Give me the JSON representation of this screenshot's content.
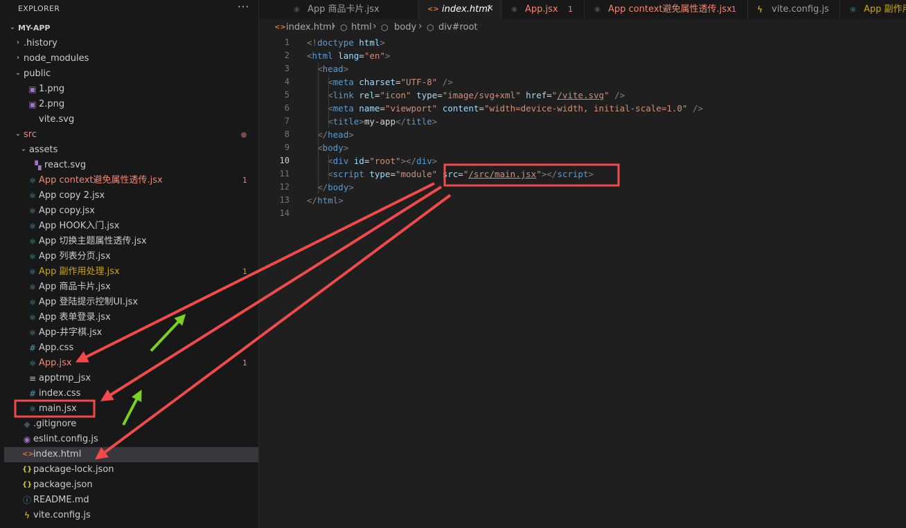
{
  "explorer": {
    "title": "EXPLORER",
    "more": "···",
    "items": [
      {
        "label": "MY-APP",
        "chev": "⌄",
        "icon": "",
        "icon_color": "",
        "depth": 0,
        "color": "root",
        "badge": "",
        "dot": false,
        "selected": false,
        "icon_name": "chevron-down-icon"
      },
      {
        "label": ".history",
        "chev": "›",
        "icon": "",
        "icon_color": "",
        "depth": 1,
        "color": "default",
        "badge": "",
        "dot": false,
        "selected": false,
        "icon_name": "chevron-right-icon"
      },
      {
        "label": "node_modules",
        "chev": "›",
        "icon": "",
        "icon_color": "",
        "depth": 1,
        "color": "default",
        "badge": "",
        "dot": false,
        "selected": false,
        "icon_name": "chevron-right-icon"
      },
      {
        "label": "public",
        "chev": "⌄",
        "icon": "",
        "icon_color": "",
        "depth": 1,
        "color": "default",
        "badge": "",
        "dot": false,
        "selected": false,
        "icon_name": "chevron-down-icon"
      },
      {
        "label": "1.png",
        "chev": "",
        "icon": "▣",
        "icon_color": "#a074c4",
        "depth": 2,
        "color": "default",
        "badge": "",
        "dot": false,
        "selected": false,
        "icon_name": "image-file-icon"
      },
      {
        "label": "2.png",
        "chev": "",
        "icon": "▣",
        "icon_color": "#a074c4",
        "depth": 2,
        "color": "default",
        "badge": "",
        "dot": false,
        "selected": false,
        "icon_name": "image-file-icon"
      },
      {
        "label": "vite.svg",
        "chev": "",
        "icon": "",
        "icon_color": "",
        "depth": 2,
        "color": "default",
        "badge": "",
        "dot": false,
        "selected": false,
        "icon_name": "svg-file-icon"
      },
      {
        "label": "src",
        "chev": "⌄",
        "icon": "",
        "icon_color": "",
        "depth": 1,
        "color": "error",
        "badge": "",
        "dot": true,
        "selected": false,
        "icon_name": "chevron-down-icon"
      },
      {
        "label": "assets",
        "chev": "⌄",
        "icon": "",
        "icon_color": "",
        "depth": 2,
        "color": "default",
        "badge": "",
        "dot": false,
        "selected": false,
        "icon_name": "chevron-down-icon"
      },
      {
        "label": "react.svg",
        "chev": "",
        "icon": "▚",
        "icon_color": "#a074c4",
        "depth": 3,
        "color": "default",
        "badge": "",
        "dot": false,
        "selected": false,
        "icon_name": "svg-file-icon"
      },
      {
        "label": "App context避免属性透传.jsx",
        "chev": "",
        "icon": "⚛",
        "icon_color": "#519aba",
        "depth": 2,
        "color": "error",
        "badge": "1",
        "dot": false,
        "selected": false,
        "icon_name": "react-file-icon"
      },
      {
        "label": "App copy 2.jsx",
        "chev": "",
        "icon": "⚛",
        "icon_color": "#519aba",
        "depth": 2,
        "color": "default",
        "badge": "",
        "dot": false,
        "selected": false,
        "icon_name": "react-file-icon"
      },
      {
        "label": "App copy.jsx",
        "chev": "",
        "icon": "⚛",
        "icon_color": "#519aba",
        "depth": 2,
        "color": "default",
        "badge": "",
        "dot": false,
        "selected": false,
        "icon_name": "react-file-icon"
      },
      {
        "label": "App HOOK入门.jsx",
        "chev": "",
        "icon": "⚛",
        "icon_color": "#519aba",
        "depth": 2,
        "color": "default",
        "badge": "",
        "dot": false,
        "selected": false,
        "icon_name": "react-file-icon"
      },
      {
        "label": "App 切换主题属性透传.jsx",
        "chev": "",
        "icon": "⚛",
        "icon_color": "#519aba",
        "depth": 2,
        "color": "default",
        "badge": "",
        "dot": false,
        "selected": false,
        "icon_name": "react-file-icon"
      },
      {
        "label": "App 列表分页.jsx",
        "chev": "",
        "icon": "⚛",
        "icon_color": "#519aba",
        "depth": 2,
        "color": "default",
        "badge": "",
        "dot": false,
        "selected": false,
        "icon_name": "react-file-icon"
      },
      {
        "label": "App 副作用处理.jsx",
        "chev": "",
        "icon": "⚛",
        "icon_color": "#519aba",
        "depth": 2,
        "color": "warn",
        "badge": "1",
        "dot": false,
        "selected": false,
        "icon_name": "react-file-icon"
      },
      {
        "label": "App 商品卡片.jsx",
        "chev": "",
        "icon": "⚛",
        "icon_color": "#519aba",
        "depth": 2,
        "color": "default",
        "badge": "",
        "dot": false,
        "selected": false,
        "icon_name": "react-file-icon"
      },
      {
        "label": "App 登陆提示控制UI.jsx",
        "chev": "",
        "icon": "⚛",
        "icon_color": "#519aba",
        "depth": 2,
        "color": "default",
        "badge": "",
        "dot": false,
        "selected": false,
        "icon_name": "react-file-icon"
      },
      {
        "label": "App 表单登录.jsx",
        "chev": "",
        "icon": "⚛",
        "icon_color": "#519aba",
        "depth": 2,
        "color": "default",
        "badge": "",
        "dot": false,
        "selected": false,
        "icon_name": "react-file-icon"
      },
      {
        "label": "App-井字棋.jsx",
        "chev": "",
        "icon": "⚛",
        "icon_color": "#519aba",
        "depth": 2,
        "color": "default",
        "badge": "",
        "dot": false,
        "selected": false,
        "icon_name": "react-file-icon"
      },
      {
        "label": "App.css",
        "chev": "",
        "icon": "#",
        "icon_color": "#519aba",
        "depth": 2,
        "color": "default",
        "badge": "",
        "dot": false,
        "selected": false,
        "icon_name": "css-file-icon"
      },
      {
        "label": "App.jsx",
        "chev": "",
        "icon": "⚛",
        "icon_color": "#519aba",
        "depth": 2,
        "color": "error",
        "badge": "1",
        "dot": false,
        "selected": false,
        "icon_name": "react-file-icon"
      },
      {
        "label": "apptmp_jsx",
        "chev": "",
        "icon": "≡",
        "icon_color": "#c5c5c5",
        "depth": 2,
        "color": "default",
        "badge": "",
        "dot": false,
        "selected": false,
        "icon_name": "text-file-icon"
      },
      {
        "label": "index.css",
        "chev": "",
        "icon": "#",
        "icon_color": "#519aba",
        "depth": 2,
        "color": "default",
        "badge": "",
        "dot": false,
        "selected": false,
        "icon_name": "css-file-icon"
      },
      {
        "label": "main.jsx",
        "chev": "",
        "icon": "⚛",
        "icon_color": "#519aba",
        "depth": 2,
        "color": "default",
        "badge": "",
        "dot": false,
        "selected": false,
        "icon_name": "react-file-icon"
      },
      {
        "label": ".gitignore",
        "chev": "",
        "icon": "◆",
        "icon_color": "#41535b",
        "depth": 1,
        "color": "default",
        "badge": "",
        "dot": false,
        "selected": false,
        "icon_name": "git-file-icon"
      },
      {
        "label": "eslint.config.js",
        "chev": "",
        "icon": "◉",
        "icon_color": "#a074c4",
        "depth": 1,
        "color": "default",
        "badge": "",
        "dot": false,
        "selected": false,
        "icon_name": "eslint-file-icon"
      },
      {
        "label": "index.html",
        "chev": "",
        "icon": "<>",
        "icon_color": "#e37933",
        "depth": 1,
        "color": "default",
        "badge": "",
        "dot": false,
        "selected": true,
        "icon_name": "html-file-icon"
      },
      {
        "label": "package-lock.json",
        "chev": "",
        "icon": "{}",
        "icon_color": "#cbcb41",
        "depth": 1,
        "color": "default",
        "badge": "",
        "dot": false,
        "selected": false,
        "icon_name": "json-file-icon"
      },
      {
        "label": "package.json",
        "chev": "",
        "icon": "{}",
        "icon_color": "#cbcb41",
        "depth": 1,
        "color": "default",
        "badge": "",
        "dot": false,
        "selected": false,
        "icon_name": "json-file-icon"
      },
      {
        "label": "README.md",
        "chev": "",
        "icon": "ⓘ",
        "icon_color": "#519aba",
        "depth": 1,
        "color": "default",
        "badge": "",
        "dot": false,
        "selected": false,
        "icon_name": "info-file-icon"
      },
      {
        "label": "vite.config.js",
        "chev": "",
        "icon": "ϟ",
        "icon_color": "#f5d90a",
        "depth": 1,
        "color": "default",
        "badge": "",
        "dot": false,
        "selected": false,
        "icon_name": "vite-file-icon"
      }
    ]
  },
  "tabs": [
    {
      "label": "App 商品卡片.jsx",
      "icon": "⚛",
      "icon_color": "#519aba",
      "icon_name": "react-file-icon",
      "color": "#9d9d9d",
      "italic": false,
      "badge": "",
      "close": "",
      "active": false
    },
    {
      "label": "index.html",
      "icon": "<>",
      "icon_color": "#e37933",
      "icon_name": "html-file-icon",
      "color": "#ffffff",
      "italic": true,
      "badge": "",
      "close": "✕",
      "active": true
    },
    {
      "label": "App.jsx",
      "icon": "⚛",
      "icon_color": "#519aba",
      "icon_name": "react-file-icon",
      "color": "#f48771",
      "italic": false,
      "badge": "1",
      "close": "",
      "active": false
    },
    {
      "label": "App context避免属性透传.jsx",
      "icon": "⚛",
      "icon_color": "#519aba",
      "icon_name": "react-file-icon",
      "color": "#f48771",
      "italic": false,
      "badge": "1",
      "close": "",
      "active": false
    },
    {
      "label": "vite.config.js",
      "icon": "ϟ",
      "icon_color": "#f5d90a",
      "icon_name": "vite-file-icon",
      "color": "#9d9d9d",
      "italic": false,
      "badge": "",
      "close": "",
      "active": false
    },
    {
      "label": "App 副作用处理.jsx",
      "icon": "⚛",
      "icon_color": "#519aba",
      "icon_name": "react-file-icon",
      "color": "#cca700",
      "italic": false,
      "badge": "",
      "close": "",
      "active": false
    }
  ],
  "breadcrumb": [
    {
      "label": "index.html",
      "icon": "<>",
      "icon_color": "#e37933",
      "icon_name": "html-file-icon"
    },
    {
      "label": "html",
      "icon": "⬡",
      "icon_color": "#a9a9a9",
      "icon_name": "element-icon"
    },
    {
      "label": "body",
      "icon": "⬡",
      "icon_color": "#a9a9a9",
      "icon_name": "element-icon"
    },
    {
      "label": "div#root",
      "icon": "⬡",
      "icon_color": "#a9a9a9",
      "icon_name": "element-icon"
    }
  ],
  "editor": {
    "current_line": 10,
    "lines": [
      {
        "n": "1",
        "tokens": [
          [
            "p",
            "<!"
          ],
          [
            "t",
            "doctype"
          ],
          [
            "x",
            " "
          ],
          [
            "a",
            "html"
          ],
          [
            "p",
            ">"
          ]
        ]
      },
      {
        "n": "2",
        "tokens": [
          [
            "p",
            "<"
          ],
          [
            "t",
            "html"
          ],
          [
            "x",
            " "
          ],
          [
            "a",
            "lang"
          ],
          [
            "x",
            "="
          ],
          [
            "v",
            "\"en\""
          ],
          [
            "p",
            ">"
          ]
        ]
      },
      {
        "n": "3",
        "tokens": [
          [
            "x",
            "  "
          ],
          [
            "p",
            "<"
          ],
          [
            "t",
            "head"
          ],
          [
            "p",
            ">"
          ]
        ]
      },
      {
        "n": "4",
        "tokens": [
          [
            "x",
            "    "
          ],
          [
            "p",
            "<"
          ],
          [
            "t",
            "meta"
          ],
          [
            "x",
            " "
          ],
          [
            "a",
            "charset"
          ],
          [
            "x",
            "="
          ],
          [
            "v",
            "\"UTF-8\""
          ],
          [
            "x",
            " "
          ],
          [
            "p",
            "/>"
          ]
        ]
      },
      {
        "n": "5",
        "tokens": [
          [
            "x",
            "    "
          ],
          [
            "p",
            "<"
          ],
          [
            "t",
            "link"
          ],
          [
            "x",
            " "
          ],
          [
            "a",
            "rel"
          ],
          [
            "x",
            "="
          ],
          [
            "v",
            "\"icon\""
          ],
          [
            "x",
            " "
          ],
          [
            "a",
            "type"
          ],
          [
            "x",
            "="
          ],
          [
            "v",
            "\"image/svg+xml\""
          ],
          [
            "x",
            " "
          ],
          [
            "a",
            "href"
          ],
          [
            "x",
            "="
          ],
          [
            "v",
            "\""
          ],
          [
            "u",
            "/vite.svg"
          ],
          [
            "v",
            "\""
          ],
          [
            "x",
            " "
          ],
          [
            "p",
            "/>"
          ]
        ]
      },
      {
        "n": "6",
        "tokens": [
          [
            "x",
            "    "
          ],
          [
            "p",
            "<"
          ],
          [
            "t",
            "meta"
          ],
          [
            "x",
            " "
          ],
          [
            "a",
            "name"
          ],
          [
            "x",
            "="
          ],
          [
            "v",
            "\"viewport\""
          ],
          [
            "x",
            " "
          ],
          [
            "a",
            "content"
          ],
          [
            "x",
            "="
          ],
          [
            "v",
            "\"width=device-width, initial-scale=1.0\""
          ],
          [
            "x",
            " "
          ],
          [
            "p",
            "/>"
          ]
        ]
      },
      {
        "n": "7",
        "tokens": [
          [
            "x",
            "    "
          ],
          [
            "p",
            "<"
          ],
          [
            "t",
            "title"
          ],
          [
            "p",
            ">"
          ],
          [
            "x",
            "my-app"
          ],
          [
            "p",
            "</"
          ],
          [
            "t",
            "title"
          ],
          [
            "p",
            ">"
          ]
        ]
      },
      {
        "n": "8",
        "tokens": [
          [
            "x",
            "  "
          ],
          [
            "p",
            "</"
          ],
          [
            "t",
            "head"
          ],
          [
            "p",
            ">"
          ]
        ]
      },
      {
        "n": "9",
        "tokens": [
          [
            "x",
            "  "
          ],
          [
            "p",
            "<"
          ],
          [
            "t",
            "body"
          ],
          [
            "p",
            ">"
          ]
        ]
      },
      {
        "n": "10",
        "tokens": [
          [
            "x",
            "    "
          ],
          [
            "p",
            "<"
          ],
          [
            "t",
            "div"
          ],
          [
            "x",
            " "
          ],
          [
            "a",
            "id"
          ],
          [
            "x",
            "="
          ],
          [
            "v",
            "\"root\""
          ],
          [
            "p",
            "></"
          ],
          [
            "t",
            "div"
          ],
          [
            "p",
            ">"
          ]
        ]
      },
      {
        "n": "11",
        "tokens": [
          [
            "x",
            "    "
          ],
          [
            "p",
            "<"
          ],
          [
            "t",
            "script"
          ],
          [
            "x",
            " "
          ],
          [
            "a",
            "type"
          ],
          [
            "x",
            "="
          ],
          [
            "v",
            "\"module\""
          ],
          [
            "x",
            " "
          ],
          [
            "a",
            "src"
          ],
          [
            "x",
            "="
          ],
          [
            "v",
            "\""
          ],
          [
            "u",
            "/src/main.jsx"
          ],
          [
            "v",
            "\""
          ],
          [
            "p",
            "></"
          ],
          [
            "t",
            "script"
          ],
          [
            "p",
            ">"
          ]
        ]
      },
      {
        "n": "12",
        "tokens": [
          [
            "x",
            "  "
          ],
          [
            "p",
            "</"
          ],
          [
            "t",
            "body"
          ],
          [
            "p",
            ">"
          ]
        ]
      },
      {
        "n": "13",
        "tokens": [
          [
            "p",
            "</"
          ],
          [
            "t",
            "html"
          ],
          [
            "p",
            ">"
          ]
        ]
      },
      {
        "n": "14",
        "tokens": []
      }
    ]
  },
  "annotation_colors": {
    "highlight": "#f04a4a",
    "red_arrow": "#f04a4a",
    "green_arrow": "#7bd21e"
  }
}
